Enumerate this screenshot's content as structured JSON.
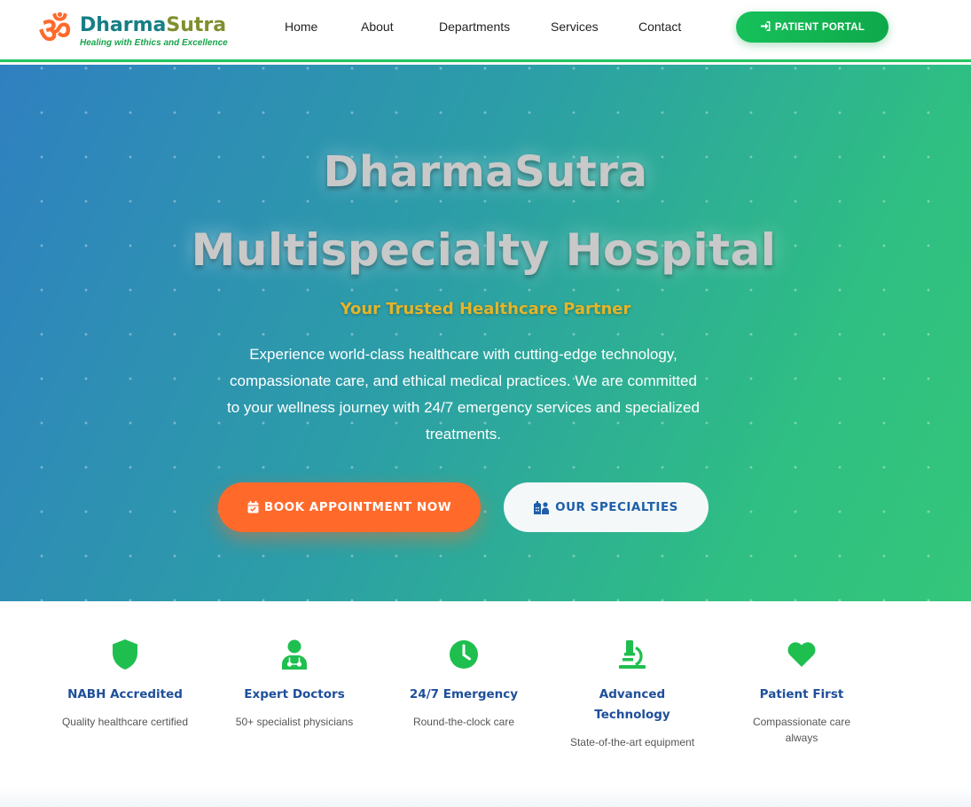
{
  "colors": {
    "brand_teal": "#157f85",
    "brand_olive": "#7f8f2e",
    "accent_orange": "#ff6a2b",
    "accent_green": "#16a34a",
    "gold": "#e3b52a",
    "feature_title_blue": "#1e4f9a",
    "icon_green": "#1fbf4f"
  },
  "header": {
    "logo_symbol": "ॐ",
    "brand_part1": "Dharma",
    "brand_part2": "Sutra",
    "tagline": "Healing with Ethics and Excellence",
    "nav": [
      {
        "label": "Home"
      },
      {
        "label": "About"
      },
      {
        "label": "Departments"
      },
      {
        "label": "Services"
      },
      {
        "label": "Contact"
      }
    ],
    "portal_button": {
      "label": "PATIENT PORTAL",
      "icon": "sign-in-icon"
    }
  },
  "hero": {
    "title_line1": "DharmaSutra",
    "title_line2": "Multispecialty Hospital",
    "subtitle": "Your Trusted Healthcare Partner",
    "description": "Experience world-class healthcare with cutting-edge technology, compassionate care, and ethical medical practices. We are committed to your wellness journey with 24/7 emergency services and specialized treatments.",
    "primary_button": {
      "label": "BOOK APPOINTMENT NOW",
      "icon": "calendar-check-icon"
    },
    "secondary_button": {
      "label": "OUR SPECIALTIES",
      "icon": "hospital-user-icon"
    }
  },
  "features": [
    {
      "icon": "shield-icon",
      "title": "NABH Accredited",
      "desc": "Quality healthcare certified"
    },
    {
      "icon": "doctor-icon",
      "title": "Expert Doctors",
      "desc": "50+ specialist physicians"
    },
    {
      "icon": "clock-icon",
      "title": "24/7 Emergency",
      "desc": "Round-the-clock care"
    },
    {
      "icon": "microscope-icon",
      "title": "Advanced Technology",
      "desc": "State-of-the-art equipment"
    },
    {
      "icon": "heart-icon",
      "title": "Patient First",
      "desc": "Compassionate care always"
    }
  ]
}
